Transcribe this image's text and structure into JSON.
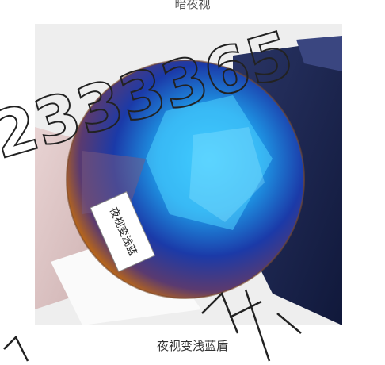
{
  "captions": {
    "top": "暗夜视",
    "bottom": "夜视变浅蓝盾"
  },
  "lens_label": {
    "text": "夜视变浅蓝"
  },
  "watermark": {
    "digits": "2333365"
  },
  "colors": {
    "background": "#ffffff",
    "lens_blue": "#1e9be8",
    "lens_deep": "#1b3aa8",
    "lens_amber": "#b3641e",
    "box_navy": "#1a2450",
    "paper_pink": "#e3c9c9"
  }
}
